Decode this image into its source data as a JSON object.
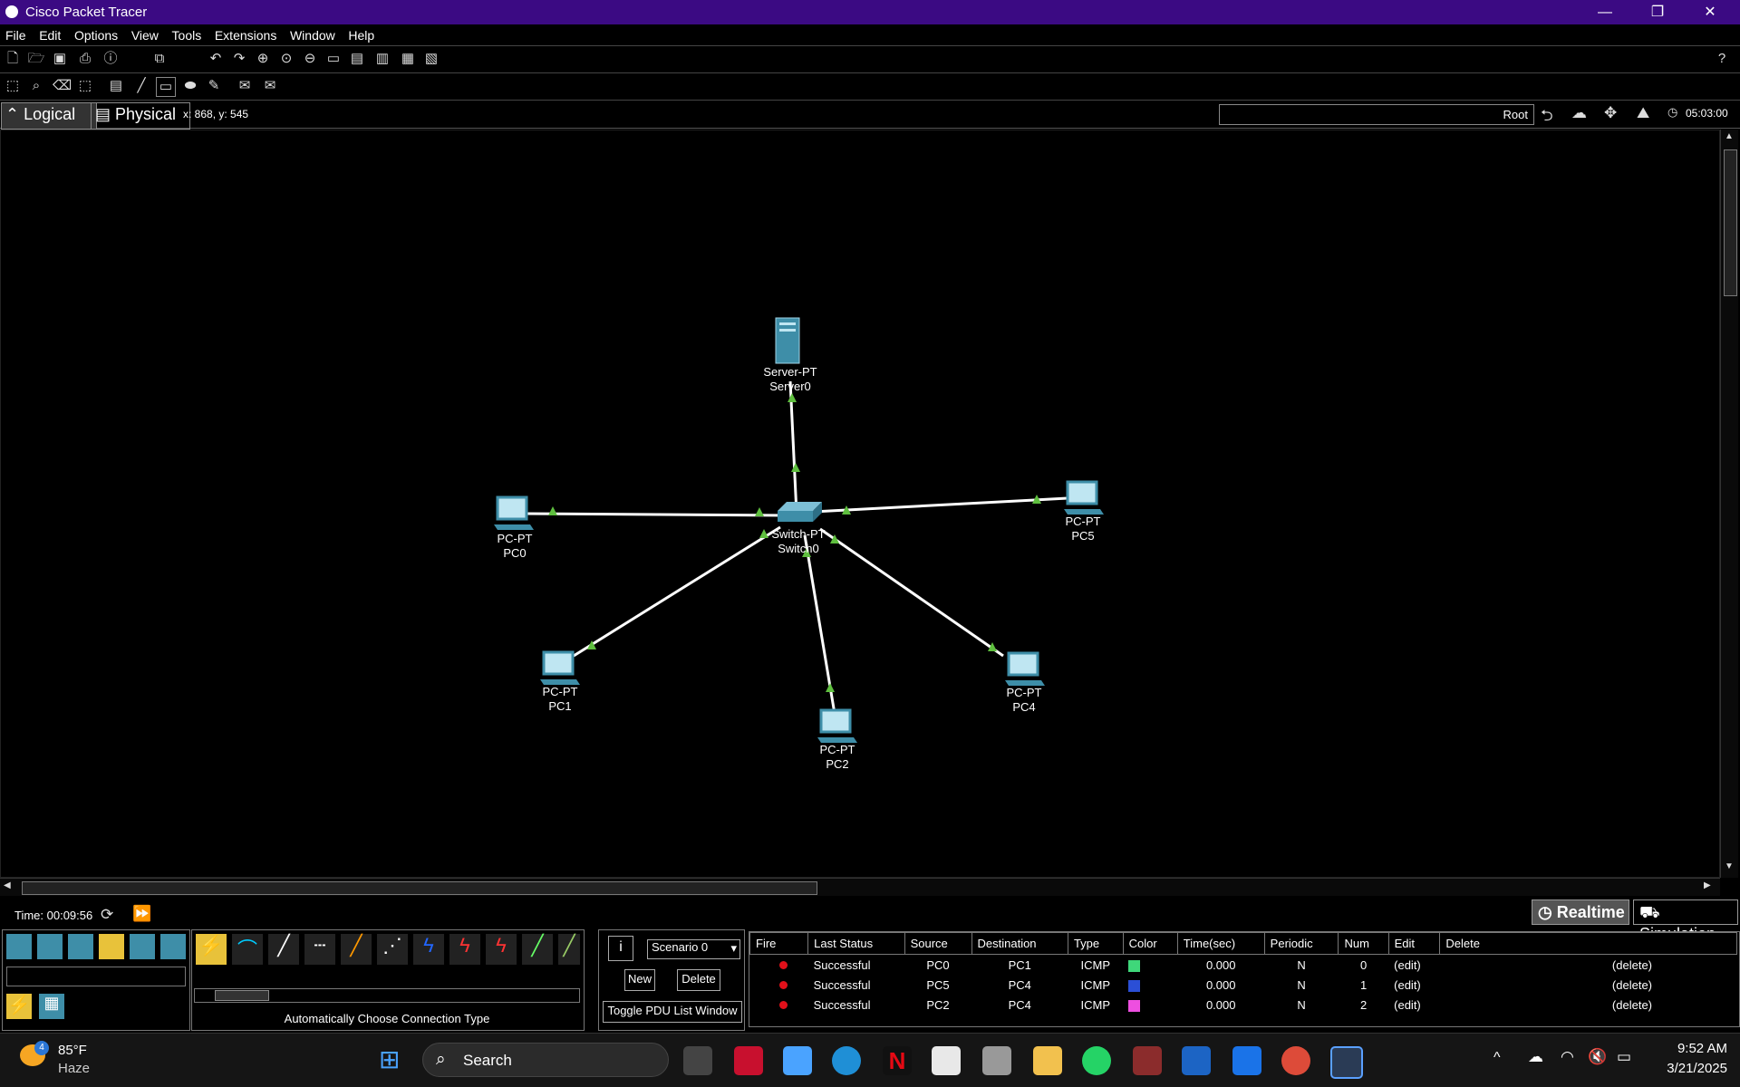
{
  "window": {
    "title": "Cisco Packet Tracer",
    "controls": [
      "—",
      "❐",
      "✕"
    ]
  },
  "menu": [
    "File",
    "Edit",
    "Options",
    "View",
    "Tools",
    "Extensions",
    "Window",
    "Help"
  ],
  "toolbar_main": [
    "new-file-icon",
    "open-folder-icon",
    "save-icon",
    "print-icon",
    "info-icon",
    "activity-wizard-icon",
    "copy-icon",
    "paste-icon",
    "undo-icon",
    "redo-icon",
    "zoom-in-icon",
    "zoom-reset-icon",
    "zoom-out-icon",
    "drawing-palette-icon",
    "custom-device-icon",
    "viewport-icon",
    "cluster-icon",
    "workspace-icon"
  ],
  "toolbar_secondary": [
    "select-icon",
    "inspect-icon",
    "delete-icon",
    "resize-icon",
    "note-icon",
    "draw-line-icon",
    "rectangle-icon",
    "ellipse-icon",
    "freeform-icon",
    "add-simple-pdu-icon",
    "add-complex-pdu-icon"
  ],
  "viewbar": {
    "logical_label": "Logical",
    "physical_label": "Physical",
    "coords": "x: 868, y: 545",
    "root_label": "Root",
    "clock": "05:03:00"
  },
  "devices": {
    "server0": {
      "model": "Server-PT",
      "name": "Server0"
    },
    "switch0": {
      "model": "Switch-PT",
      "name": "Switch0"
    },
    "pc0": {
      "model": "PC-PT",
      "name": "PC0"
    },
    "pc1": {
      "model": "PC-PT",
      "name": "PC1"
    },
    "pc2": {
      "model": "PC-PT",
      "name": "PC2"
    },
    "pc4": {
      "model": "PC-PT",
      "name": "PC4"
    },
    "pc5": {
      "model": "PC-PT",
      "name": "PC5"
    }
  },
  "link_color": "#ffffff",
  "link_status_color": "#5fbf3f",
  "bottom": {
    "time_label": "Time: 00:09:56",
    "realtime_label": "Realtime",
    "simulation_label": "Simulation",
    "connection_hint": "Automatically Choose Connection Type",
    "scenario": "Scenario 0",
    "new_label": "New",
    "delete_label": "Delete",
    "toggle_label": "Toggle PDU List Window",
    "pdu_headers": [
      "Fire",
      "Last Status",
      "Source",
      "Destination",
      "Type",
      "Color",
      "Time(sec)",
      "Periodic",
      "Num",
      "Edit",
      "Delete"
    ],
    "pdu_rows": [
      {
        "status": "Successful",
        "source": "PC0",
        "destination": "PC1",
        "type": "ICMP",
        "color": "#3fd77a",
        "time": "0.000",
        "periodic": "N",
        "num": "0",
        "edit": "(edit)",
        "delete": "(delete)"
      },
      {
        "status": "Successful",
        "source": "PC5",
        "destination": "PC4",
        "type": "ICMP",
        "color": "#2b4fd6",
        "time": "0.000",
        "periodic": "N",
        "num": "1",
        "edit": "(edit)",
        "delete": "(delete)"
      },
      {
        "status": "Successful",
        "source": "PC2",
        "destination": "PC4",
        "type": "ICMP",
        "color": "#ee4fe0",
        "time": "0.000",
        "periodic": "N",
        "num": "2",
        "edit": "(edit)",
        "delete": "(delete)"
      }
    ]
  },
  "taskbar": {
    "weather_temp": "85°F",
    "weather_desc": "Haze",
    "weather_badge": "4",
    "search_label": "Search",
    "time": "9:52 AM",
    "date": "3/21/2025"
  }
}
